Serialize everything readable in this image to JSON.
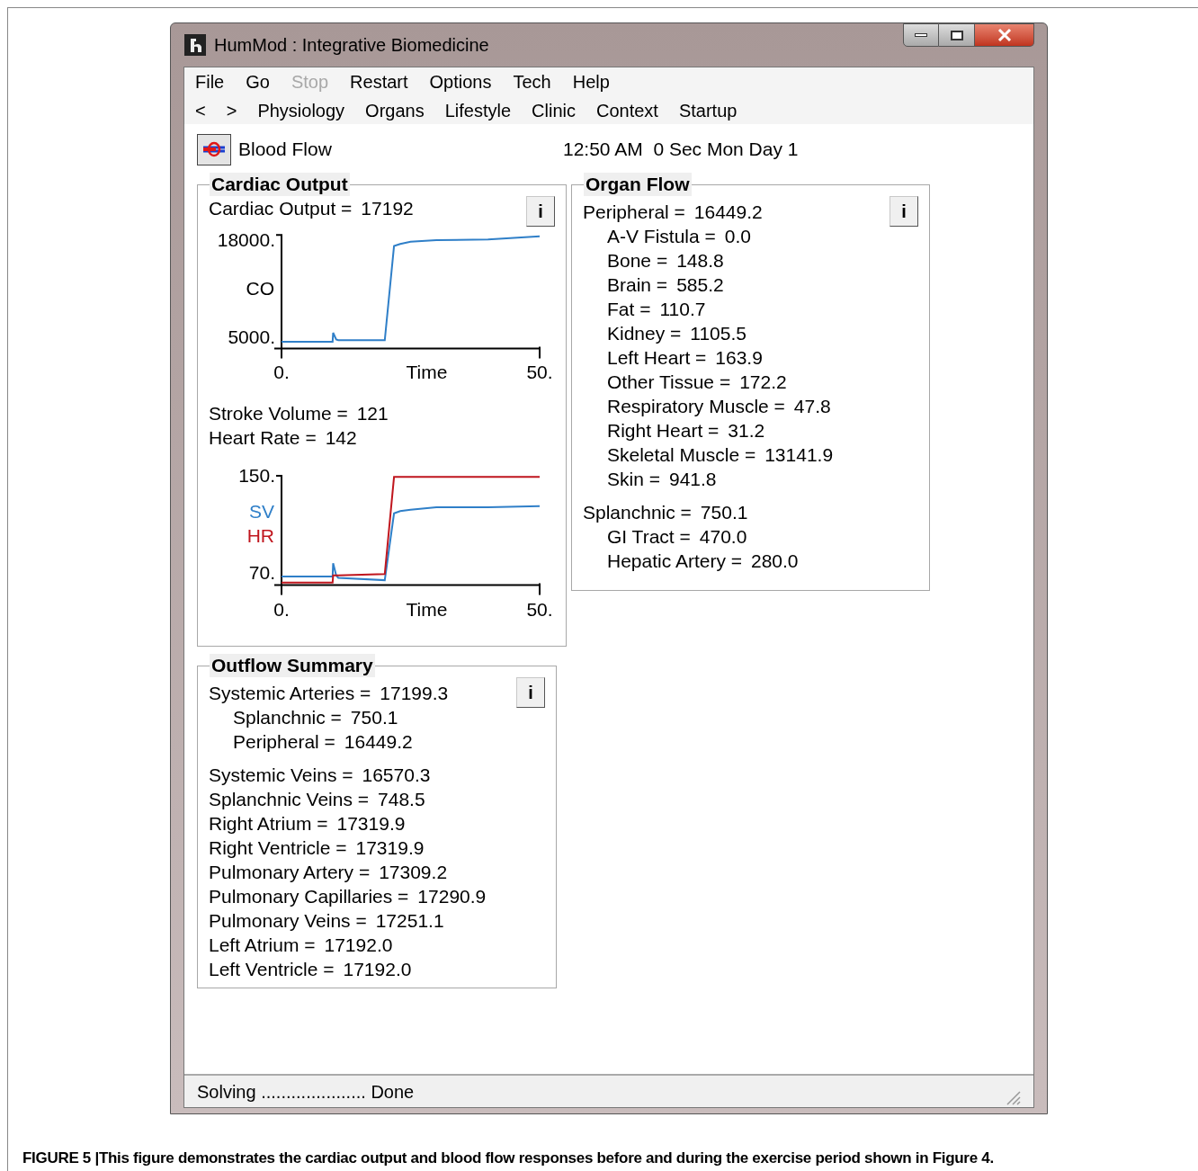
{
  "window": {
    "title": "HumMod : Integrative Biomedicine"
  },
  "menu": [
    {
      "label": "File",
      "disabled": false
    },
    {
      "label": "Go",
      "disabled": false
    },
    {
      "label": "Stop",
      "disabled": true
    },
    {
      "label": "Restart",
      "disabled": false
    },
    {
      "label": "Options",
      "disabled": false
    },
    {
      "label": "Tech",
      "disabled": false
    },
    {
      "label": "Help",
      "disabled": false
    }
  ],
  "nav": [
    {
      "label": "<"
    },
    {
      "label": ">"
    },
    {
      "label": "Physiology"
    },
    {
      "label": "Organs"
    },
    {
      "label": "Lifestyle"
    },
    {
      "label": "Clinic"
    },
    {
      "label": "Context"
    },
    {
      "label": "Startup"
    }
  ],
  "header": {
    "title": "Blood Flow",
    "clock": "12:50 AM  0 Sec Mon Day 1"
  },
  "cardiac_output": {
    "title": "Cardiac Output",
    "info_button": "i",
    "readout": {
      "label": "Cardiac Output =",
      "value": "17192"
    },
    "chart_co": {
      "chart_data": {
        "type": "line",
        "xlabel": "Time",
        "x": [
          0,
          9.9,
          10,
          10.6,
          11,
          20,
          21.8,
          23,
          25,
          30,
          40,
          50
        ],
        "xlim": [
          0,
          50
        ],
        "ylim": [
          3500,
          18700
        ],
        "series": [
          {
            "name": "CO",
            "color": "#2f7fc8",
            "values": [
              4400,
              4400,
              5600,
              4700,
              4600,
              4600,
              17200,
              17500,
              17800,
              18000,
              18100,
              18500
            ]
          }
        ],
        "xticks": [
          {
            "value": 0,
            "label": "0."
          },
          {
            "value": 50,
            "label": "50."
          }
        ],
        "yticks": [
          {
            "value": 5000,
            "label": "5000."
          },
          {
            "value": 18000,
            "label": "18000."
          }
        ]
      }
    },
    "readouts": [
      {
        "label": "Stroke Volume =",
        "value": "121"
      },
      {
        "label": "Heart Rate =",
        "value": "142"
      }
    ],
    "chart_sv_hr": {
      "chart_data": {
        "type": "line",
        "xlabel": "Time",
        "x": [
          0,
          9.9,
          10,
          10.6,
          11,
          20,
          21.8,
          23,
          25,
          30,
          40,
          50
        ],
        "xlim": [
          0,
          50
        ],
        "ylim": [
          60,
          150
        ],
        "series": [
          {
            "name": "SV",
            "color": "#2f7fc8",
            "values": [
              67,
              67,
              78,
              68,
              66,
              64,
              119,
              121,
              122,
              124,
              124,
              125
            ]
          },
          {
            "name": "HR",
            "color": "#c0161e",
            "values": [
              62,
              62,
              68,
              68,
              68,
              69,
              149,
              149,
              149,
              149,
              149,
              149
            ]
          }
        ],
        "xticks": [
          {
            "value": 0,
            "label": "0."
          },
          {
            "value": 50,
            "label": "50."
          }
        ],
        "yticks": [
          {
            "value": 70,
            "label": "70."
          },
          {
            "value": 150,
            "label": "150."
          }
        ]
      }
    }
  },
  "organ_flow": {
    "title": "Organ Flow",
    "info_button": "i",
    "rows": [
      {
        "label": "Peripheral =",
        "value": "16449.2",
        "children": [
          {
            "label": "A-V Fistula =",
            "value": "0.0"
          },
          {
            "label": "Bone =",
            "value": "148.8"
          },
          {
            "label": "Brain =",
            "value": "585.2"
          },
          {
            "label": "Fat =",
            "value": "110.7"
          },
          {
            "label": "Kidney =",
            "value": "1105.5"
          },
          {
            "label": "Left Heart =",
            "value": "163.9"
          },
          {
            "label": "Other Tissue =",
            "value": "172.2"
          },
          {
            "label": "Respiratory Muscle =",
            "value": "47.8"
          },
          {
            "label": "Right Heart =",
            "value": "31.2"
          },
          {
            "label": "Skeletal Muscle =",
            "value": "13141.9"
          },
          {
            "label": "Skin =",
            "value": "941.8"
          }
        ]
      },
      {
        "label": "Splanchnic =",
        "value": "750.1",
        "children": [
          {
            "label": "GI Tract =",
            "value": "470.0"
          },
          {
            "label": "Hepatic Artery =",
            "value": "280.0"
          }
        ]
      }
    ]
  },
  "outflow_summary": {
    "title": "Outflow Summary",
    "info_button": "i",
    "rows": [
      {
        "label": "Systemic Arteries =",
        "value": "17199.3",
        "children": [
          {
            "label": "Splanchnic =",
            "value": "750.1"
          },
          {
            "label": "Peripheral =",
            "value": "16449.2"
          }
        ]
      },
      {
        "label": "Systemic Veins =",
        "value": "16570.3"
      },
      {
        "label": "Splanchnic Veins =",
        "value": "748.5"
      },
      {
        "label": "Right Atrium =",
        "value": "17319.9"
      },
      {
        "label": "Right Ventricle =",
        "value": "17319.9"
      },
      {
        "label": "Pulmonary Artery =",
        "value": "17309.2"
      },
      {
        "label": "Pulmonary Capillaries =",
        "value": "17290.9"
      },
      {
        "label": "Pulmonary Veins =",
        "value": "17251.1"
      },
      {
        "label": "Left Atrium =",
        "value": "17192.0"
      },
      {
        "label": "Left Ventricle =",
        "value": "17192.0"
      }
    ]
  },
  "status_bar": {
    "text": "Solving ..................... Done"
  },
  "caption": "FIGURE 5 |This figure demonstrates the cardiac output and blood flow responses before and during the exercise period shown in Figure 4."
}
